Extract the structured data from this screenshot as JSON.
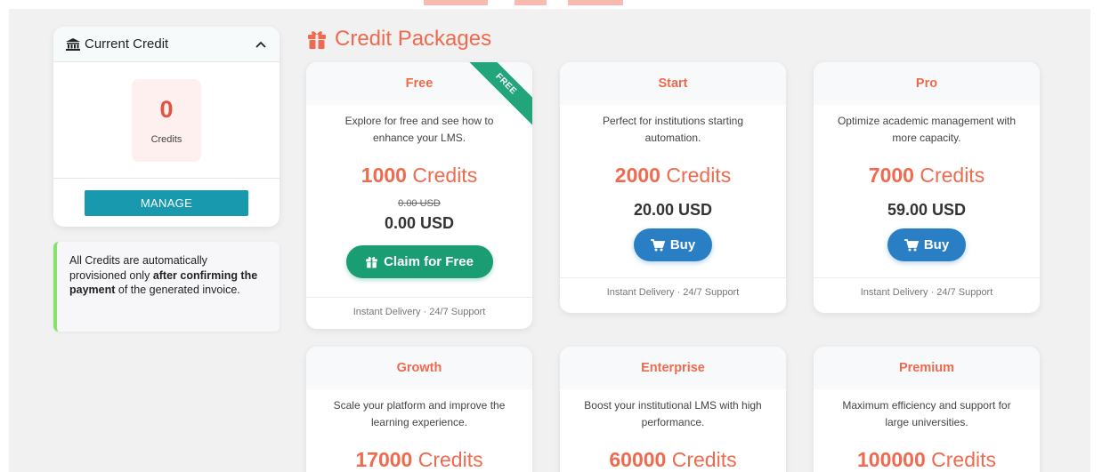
{
  "current_credit": {
    "title": "Current Credit",
    "value": "0",
    "unit": "Credits",
    "manage_label": "MANAGE",
    "icons": [
      "bank-icon",
      "chevron-up-icon"
    ]
  },
  "note": {
    "part1": "All Credits are automatically provisioned only ",
    "bold": "after confirming the payment",
    "part2": " of the generated invoice."
  },
  "section": {
    "title": "Credit Packages",
    "icon": "gift-icon"
  },
  "colors": {
    "accent": "#ef6a4e",
    "teal": "#1899ad",
    "green": "#1a9d73",
    "blue": "#2a7fc4",
    "note_border": "#86e26a"
  },
  "packages": [
    {
      "name": "Free",
      "ribbon": "FREE",
      "desc": "Explore for free and see how to enhance your LMS.",
      "credits": "1000",
      "credits_unit": "Credits",
      "old_price": "0.00 USD",
      "price": "0.00 USD",
      "button": "Claim for Free",
      "footer": "Instant Delivery · 24/7 Support"
    },
    {
      "name": "Start",
      "desc": "Perfect for institutions starting automation.",
      "credits": "2000",
      "credits_unit": "Credits",
      "price": "20.00 USD",
      "button": "Buy",
      "footer": "Instant Delivery · 24/7 Support"
    },
    {
      "name": "Pro",
      "desc": "Optimize academic management with more capacity.",
      "credits": "7000",
      "credits_unit": "Credits",
      "price": "59.00 USD",
      "button": "Buy",
      "footer": "Instant Delivery · 24/7 Support"
    },
    {
      "name": "Growth",
      "desc": "Scale your platform and improve the learning experience.",
      "credits": "17000",
      "credits_unit": "Credits"
    },
    {
      "name": "Enterprise",
      "desc": "Boost your institutional LMS with high performance.",
      "credits": "60000",
      "credits_unit": "Credits"
    },
    {
      "name": "Premium",
      "desc": "Maximum efficiency and support for large universities.",
      "credits": "100000",
      "credits_unit": "Credits"
    }
  ]
}
